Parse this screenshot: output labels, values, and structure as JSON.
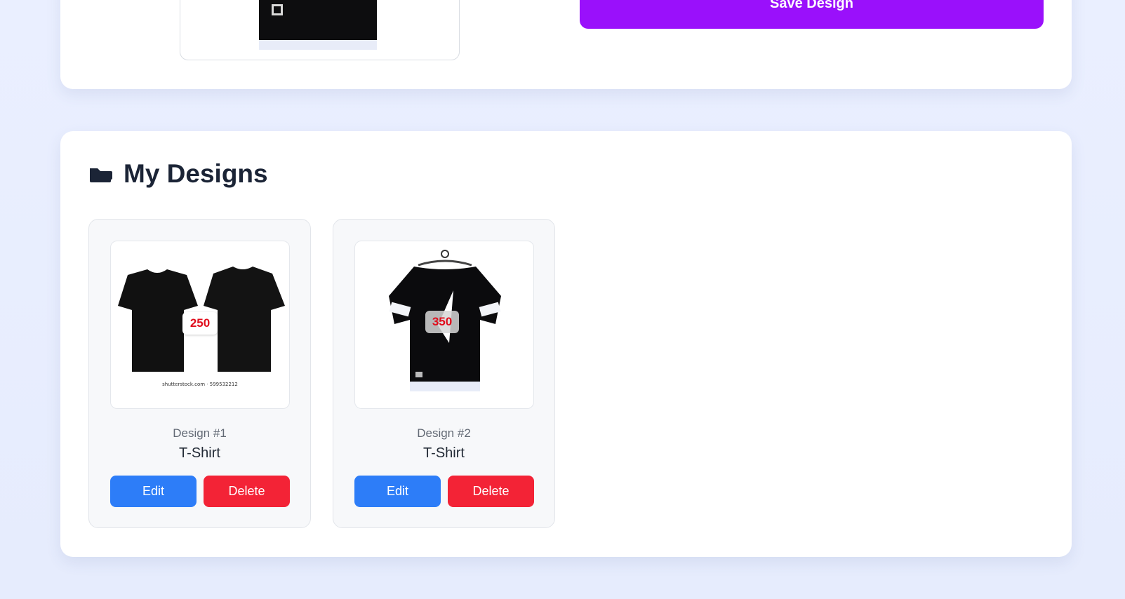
{
  "top_section": {
    "save_label": "Save Design"
  },
  "my_designs": {
    "title": "My Designs",
    "icon": "folder-icon",
    "designs": [
      {
        "number_label": "Design #1",
        "type": "T-Shirt",
        "price": "250",
        "watermark": "shutterstock.com · 599532212",
        "edit_label": "Edit",
        "delete_label": "Delete"
      },
      {
        "number_label": "Design #2",
        "type": "T-Shirt",
        "price": "350",
        "edit_label": "Edit",
        "delete_label": "Delete"
      }
    ]
  },
  "colors": {
    "accent_purple": "#9a10fb",
    "edit_blue": "#2d7df8",
    "delete_red": "#f32336",
    "price_red": "#e00d1c"
  }
}
